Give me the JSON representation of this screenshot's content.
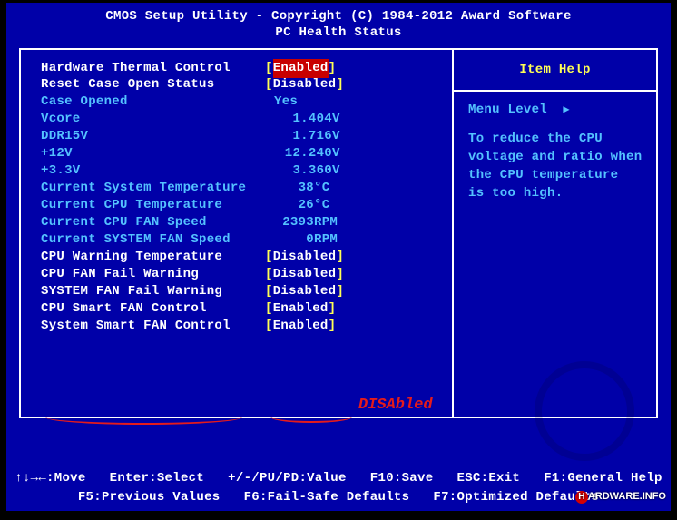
{
  "header": {
    "line1": "CMOS Setup Utility - Copyright (C) 1984-2012 Award Software",
    "line2": "PC Health Status"
  },
  "items": [
    {
      "type": "opt",
      "label": "Hardware Thermal Control",
      "value": "Enabled",
      "selected": true
    },
    {
      "type": "opt",
      "label": "Reset Case Open Status",
      "value": "Disabled"
    },
    {
      "type": "info",
      "label": "Case Opened",
      "value": "Yes"
    },
    {
      "type": "infov",
      "label": "Vcore",
      "num": "1.404",
      "unit": "V"
    },
    {
      "type": "infov",
      "label": "DDR15V",
      "num": "1.716",
      "unit": "V"
    },
    {
      "type": "infov",
      "label": "+12V",
      "num": "12.240",
      "unit": "V"
    },
    {
      "type": "infov",
      "label": "+3.3V",
      "num": "3.360",
      "unit": "V"
    },
    {
      "type": "infou",
      "label": "Current System Temperature",
      "num": "38",
      "unit": "°C"
    },
    {
      "type": "infou",
      "label": "Current CPU Temperature",
      "num": "26",
      "unit": "°C"
    },
    {
      "type": "infou",
      "label": "Current CPU FAN Speed",
      "num": "2393",
      "unit": " RPM"
    },
    {
      "type": "infou",
      "label": "Current SYSTEM FAN Speed",
      "num": "0",
      "unit": " RPM"
    },
    {
      "type": "opt",
      "label": "CPU Warning Temperature",
      "value": "Disabled"
    },
    {
      "type": "opt",
      "label": "CPU FAN Fail Warning",
      "value": "Disabled"
    },
    {
      "type": "opt",
      "label": "SYSTEM FAN Fail Warning",
      "value": "Disabled"
    },
    {
      "type": "opt",
      "label": "CPU Smart FAN Control",
      "value": "Enabled"
    },
    {
      "type": "opt",
      "label": "System Smart FAN Control",
      "value": "Enabled"
    }
  ],
  "help": {
    "title": "Item Help",
    "menu_level_label": "Menu Level",
    "text": "To reduce the CPU\nvoltage and ratio when\nthe CPU temperature\nis too high."
  },
  "footer": {
    "line1": "↑↓→←:Move   Enter:Select   +/-/PU/PD:Value   F10:Save   ESC:Exit   F1:General Help",
    "line2": "F5:Previous Values   F6:Fail-Safe Defaults   F7:Optimized Defaults"
  },
  "annotation": "DISAbled",
  "watermark": "ARDWARE.INFO"
}
